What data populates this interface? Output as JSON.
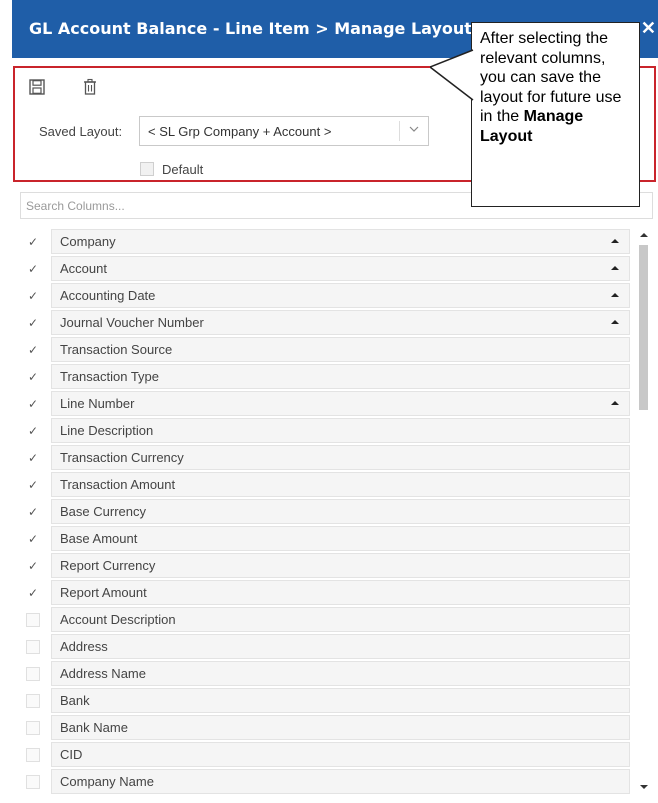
{
  "window": {
    "title": "GL Account Balance - Line Item > Manage Layout",
    "close_glyph": "✕",
    "accent_color": "#1f5ea8"
  },
  "toolbar": {
    "save_icon": "save-icon",
    "delete_icon": "trash-icon"
  },
  "saved_layout": {
    "label": "Saved Layout:",
    "value": "< SL Grp Company + Account >",
    "default_label": "Default",
    "default_checked": false
  },
  "callout": {
    "text": "After selecting the relevant columns, you can save the layout for future use in the",
    "bold_text": "Manage Layout"
  },
  "search": {
    "placeholder": "Search Columns..."
  },
  "columns": [
    {
      "label": "Company",
      "checked": true,
      "sorted": true
    },
    {
      "label": "Account",
      "checked": true,
      "sorted": true
    },
    {
      "label": "Accounting Date",
      "checked": true,
      "sorted": true
    },
    {
      "label": "Journal Voucher Number",
      "checked": true,
      "sorted": true
    },
    {
      "label": "Transaction Source",
      "checked": true,
      "sorted": false
    },
    {
      "label": "Transaction Type",
      "checked": true,
      "sorted": false
    },
    {
      "label": "Line Number",
      "checked": true,
      "sorted": true
    },
    {
      "label": "Line Description",
      "checked": true,
      "sorted": false
    },
    {
      "label": "Transaction Currency",
      "checked": true,
      "sorted": false
    },
    {
      "label": "Transaction Amount",
      "checked": true,
      "sorted": false
    },
    {
      "label": "Base Currency",
      "checked": true,
      "sorted": false
    },
    {
      "label": "Base Amount",
      "checked": true,
      "sorted": false
    },
    {
      "label": "Report Currency",
      "checked": true,
      "sorted": false
    },
    {
      "label": "Report Amount",
      "checked": true,
      "sorted": false
    },
    {
      "label": "Account Description",
      "checked": false,
      "sorted": false
    },
    {
      "label": "Address",
      "checked": false,
      "sorted": false
    },
    {
      "label": "Address Name",
      "checked": false,
      "sorted": false
    },
    {
      "label": "Bank",
      "checked": false,
      "sorted": false
    },
    {
      "label": "Bank Name",
      "checked": false,
      "sorted": false
    },
    {
      "label": "CID",
      "checked": false,
      "sorted": false
    },
    {
      "label": "Company Name",
      "checked": false,
      "sorted": false
    }
  ],
  "checkmark_glyph": "✓",
  "highlight_color": "#c9242b"
}
